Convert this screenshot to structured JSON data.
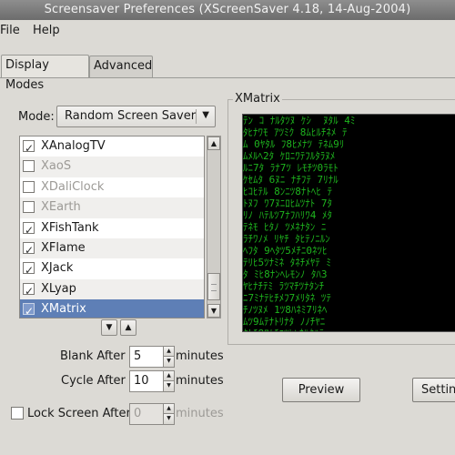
{
  "window": {
    "title": "Screensaver Preferences  (XScreenSaver 4.18, 14-Aug-2004)"
  },
  "menubar": {
    "file": "File",
    "help": "Help"
  },
  "tabs": [
    {
      "label": "Display Modes",
      "active": true
    },
    {
      "label": "Advanced",
      "active": false
    }
  ],
  "mode": {
    "label": "Mode:",
    "value": "Random Screen Saver"
  },
  "hacks": [
    {
      "name": "XAnalogTV",
      "checked": true,
      "enabled": true
    },
    {
      "name": "XaoS",
      "checked": false,
      "enabled": false
    },
    {
      "name": "XDaliClock",
      "checked": false,
      "enabled": false
    },
    {
      "name": "XEarth",
      "checked": false,
      "enabled": false
    },
    {
      "name": "XFishTank",
      "checked": true,
      "enabled": true
    },
    {
      "name": "XFlame",
      "checked": true,
      "enabled": true
    },
    {
      "name": "XJack",
      "checked": true,
      "enabled": true
    },
    {
      "name": "XLyap",
      "checked": true,
      "enabled": true
    },
    {
      "name": "XMatrix",
      "checked": true,
      "enabled": true,
      "selected": true
    }
  ],
  "blank_after": {
    "label": "Blank After",
    "value": "5",
    "unit": "minutes"
  },
  "cycle_after": {
    "label": "Cycle After",
    "value": "10",
    "unit": "minutes"
  },
  "lock_screen": {
    "label": "Lock Screen After",
    "value": "0",
    "unit": "minutes",
    "checked": false
  },
  "preview_frame": {
    "label": "XMatrix"
  },
  "buttons": {
    "preview": "Preview",
    "settings": "Settin"
  },
  "matrix_rows": [
    "ﾃﾝ ｺ ﾅﾙﾀﾂﾇ ｹｼ  ﾇﾀﾙ 4ﾐ",
    "ﾀﾋﾅﾜﾓ ｱﾂﾐｸ 8ﾑﾋﾙﾁﾈﾒ ﾃ",
    "ﾑ 0ﾔﾀﾙ ﾌ8ﾋﾒﾅﾂ ﾃﾈﾑ9ﾘ",
    "ﾑﾒﾙﾍ2ﾀ ｹﾛﾆﾜﾃﾌﾙﾀﾗﾇﾒ",
    "ﾙﾆ7ﾀ ﾗﾅ7ﾂ ﾚﾓﾁﾂ0ﾗﾓﾄ",
    "ｹｾﾑﾀ 6ﾇﾆ ﾅﾁﾌﾃ 7ﾘﾅﾙ",
    "ﾋｺﾋﾃﾙ 8ﾝﾆﾂ8ﾅﾄﾍﾋ ﾃ",
    "ﾄﾇﾌ ﾜ7ﾇﾆﾛﾋﾑﾂﾅﾄ 7ﾀ",
    "ﾘﾉ ﾊﾃﾙﾂ7ﾅﾌﾊﾘﾜ4 ﾒﾀ",
    "ﾃﾈﾓ ﾋﾀﾉ ﾂﾒﾈﾅﾀﾝ ﾆ",
    "ﾗﾁﾜﾉﾒ ﾘﾔﾁ ﾀﾋﾃﾉﾆﾙﾝ",
    "ﾍﾌﾀ 9ﾍﾀﾂ5ﾒﾁﾆ0ﾈﾂﾋ",
    "ﾃﾘﾋ5ﾂﾅﾐﾈ ﾀﾈﾁﾒﾔﾃ ﾐ",
    "ﾀ ﾐﾋ8ﾅﾝﾍﾚﾓﾝﾉ ﾀﾊ3",
    "ﾔﾋﾅﾁﾃﾐ ﾗﾂﾏﾁﾂﾅﾀﾝﾁ",
    "ﾆ7ﾐﾅﾃﾋﾁﾒﾌ7ﾒﾘﾀﾈ ﾂﾃ",
    "ﾁﾉﾂﾇﾒ 1ﾂ8ﾊﾈﾐ7ﾘﾈﾍ",
    "ﾑﾂ9ﾑﾃﾅﾄﾘﾅﾀ ﾉﾉﾁﾔﾆ",
    "ﾀﾄﾁ8ﾜﾑﾁﾆﾂﾋﾝﾈﾙﾀﾊﾃ",
    "ﾒﾝﾃﾋ 3ﾒﾂﾀﾃﾐﾂﾒﾀﾃﾚ",
    "ﾅﾋ 101ﾁﾈﾒﾚﾌﾑﾅﾁﾀﾃﾂ"
  ]
}
